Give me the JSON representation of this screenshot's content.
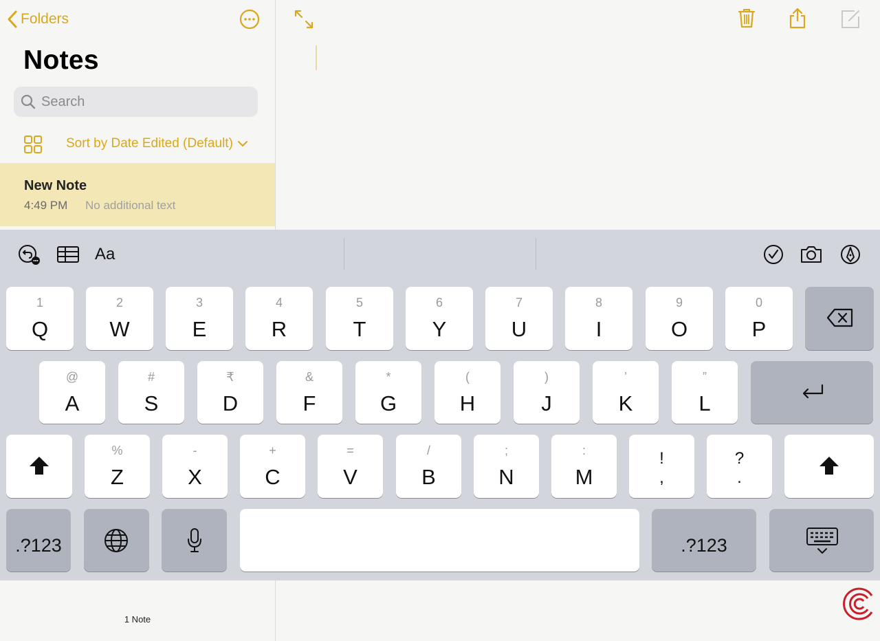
{
  "sidebar": {
    "back_label": "Folders",
    "title": "Notes",
    "search_placeholder": "Search",
    "sort_label": "Sort by Date Edited (Default)",
    "notes": [
      {
        "title": "New Note",
        "time": "4:49 PM",
        "subtitle": "No additional text"
      }
    ],
    "footer_count": "1 Note"
  },
  "toolbar": {
    "format_label": "Aa"
  },
  "keyboard": {
    "row1": [
      {
        "hint": "1",
        "label": "Q"
      },
      {
        "hint": "2",
        "label": "W"
      },
      {
        "hint": "3",
        "label": "E"
      },
      {
        "hint": "4",
        "label": "R"
      },
      {
        "hint": "5",
        "label": "T"
      },
      {
        "hint": "6",
        "label": "Y"
      },
      {
        "hint": "7",
        "label": "U"
      },
      {
        "hint": "8",
        "label": "I"
      },
      {
        "hint": "9",
        "label": "O"
      },
      {
        "hint": "0",
        "label": "P"
      }
    ],
    "row2": [
      {
        "hint": "@",
        "label": "A"
      },
      {
        "hint": "#",
        "label": "S"
      },
      {
        "hint": "₹",
        "label": "D"
      },
      {
        "hint": "&",
        "label": "F"
      },
      {
        "hint": "*",
        "label": "G"
      },
      {
        "hint": "(",
        "label": "H"
      },
      {
        "hint": ")",
        "label": "J"
      },
      {
        "hint": "’",
        "label": "K"
      },
      {
        "hint": "”",
        "label": "L"
      }
    ],
    "row3": [
      {
        "hint": "%",
        "label": "Z"
      },
      {
        "hint": "-",
        "label": "X"
      },
      {
        "hint": "+",
        "label": "C"
      },
      {
        "hint": "=",
        "label": "V"
      },
      {
        "hint": "/",
        "label": "B"
      },
      {
        "hint": ";",
        "label": "N"
      },
      {
        "hint": ":",
        "label": "M"
      }
    ],
    "row3_punct": [
      {
        "top": "!",
        "bottom": ","
      },
      {
        "top": "?",
        "bottom": "."
      }
    ],
    "numbers_label_left": ".?123",
    "numbers_label_right": ".?123"
  },
  "colors": {
    "accent": "#d9a81e",
    "selected_row": "#f3e7b5",
    "keyboard_bg": "#d3d5dc"
  }
}
